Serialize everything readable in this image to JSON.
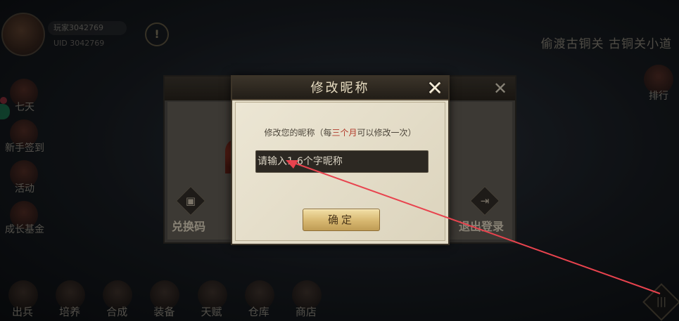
{
  "background": {
    "player": {
      "name": "玩家3042769",
      "uid": "UID 3042769"
    },
    "alert_icon": "!",
    "location": "偷渡古铜关 古铜关小道",
    "side_menu": [
      {
        "label": "七天",
        "icon": "gift-icon"
      },
      {
        "label": "新手签到",
        "icon": "checkin-icon"
      },
      {
        "label": "活动",
        "icon": "event-icon"
      },
      {
        "label": "成长基金",
        "icon": "fund-icon"
      }
    ],
    "right_item": {
      "label": "排行",
      "icon": "ranking-icon"
    },
    "bottom_menu": [
      {
        "label": "出兵",
        "icon": "troops-icon"
      },
      {
        "label": "培养",
        "icon": "train-icon"
      },
      {
        "label": "合成",
        "icon": "craft-icon"
      },
      {
        "label": "装备",
        "icon": "equipment-icon"
      },
      {
        "label": "天赋",
        "icon": "talent-icon"
      },
      {
        "label": "仓库",
        "icon": "warehouse-icon"
      },
      {
        "label": "商店",
        "icon": "shop-icon"
      }
    ],
    "corner_menu_icon": "menu-icon",
    "settings_panel": {
      "redeem_label": "兑换码",
      "logout_label": "退出登录"
    }
  },
  "dialog": {
    "title": "修改昵称",
    "hint_prefix": "修改您的昵称（每",
    "hint_accent": "三个月",
    "hint_suffix": "可以修改一次）",
    "input_placeholder": "请输入1-6个字昵称",
    "input_value": "",
    "confirm_label": "确定",
    "close_icon": "close-icon"
  },
  "colors": {
    "dialog_bg": "#e3dcc7",
    "header_bg": "#2c261f",
    "accent_text": "#b23a2a",
    "confirm_gold": "#d7b770",
    "annotation_red": "#e8434e"
  }
}
